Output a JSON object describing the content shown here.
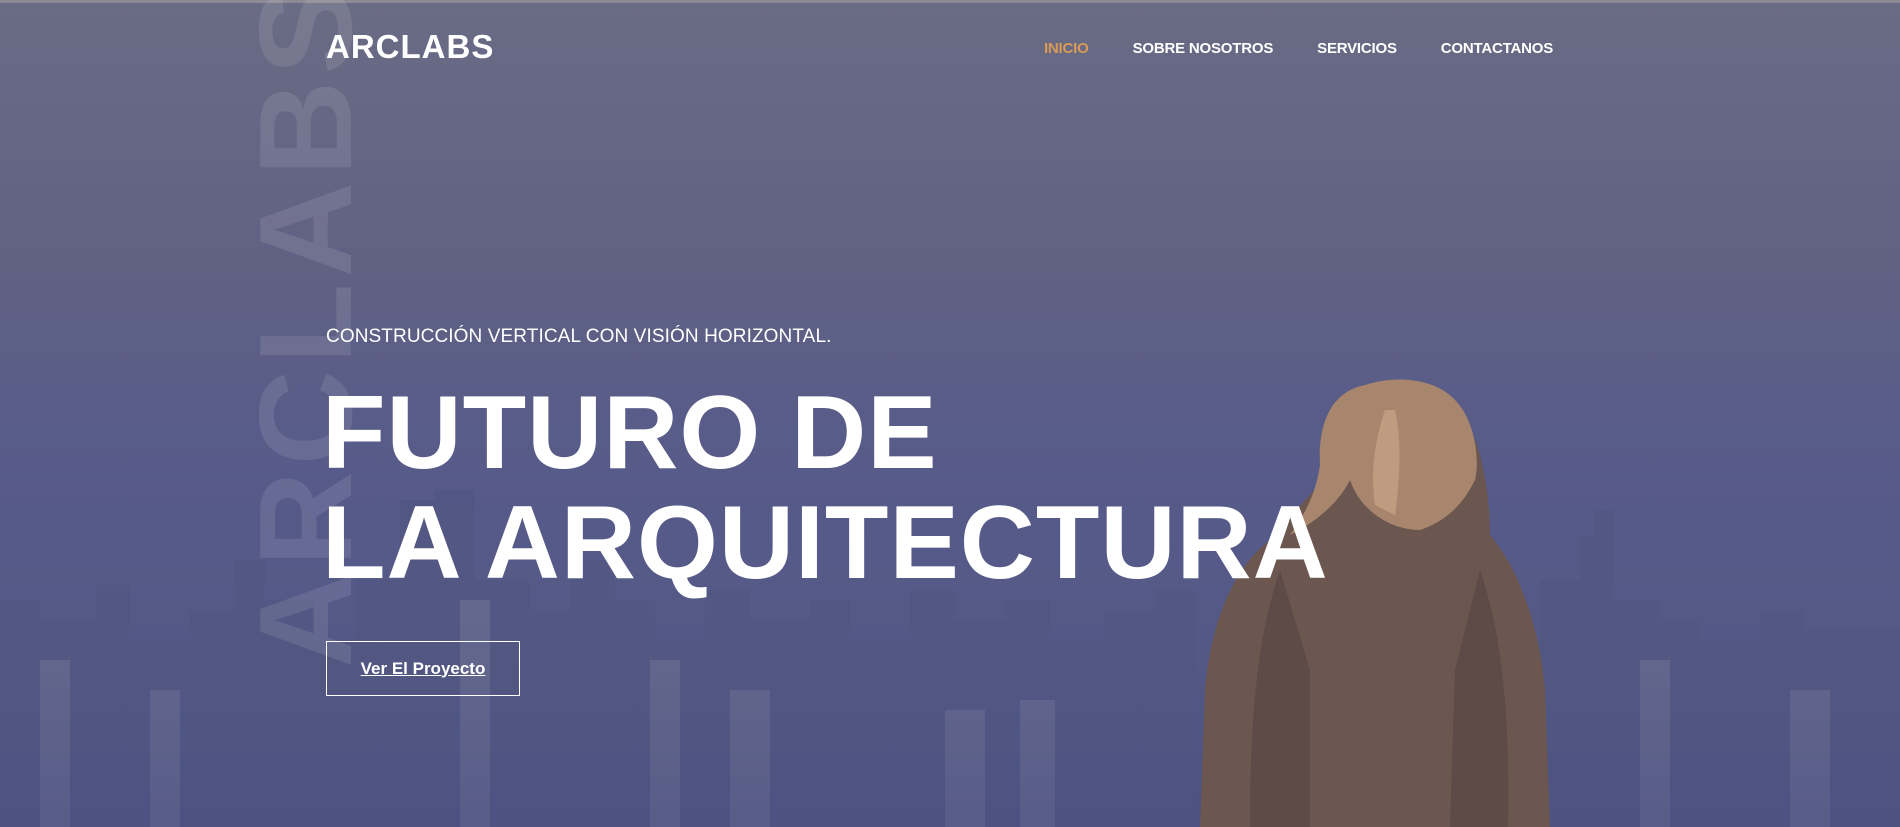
{
  "brand": {
    "logo_text": "ARCLABS",
    "watermark_text": "ARCLABS"
  },
  "nav": {
    "items": [
      {
        "label": "INICIO",
        "active": true
      },
      {
        "label": "SOBRE NOSOTROS",
        "active": false
      },
      {
        "label": "SERVICIOS",
        "active": false
      },
      {
        "label": "CONTACTANOS",
        "active": false
      }
    ]
  },
  "hero": {
    "tagline": "CONSTRUCCIÓN VERTICAL CON VISIÓN HORIZONTAL.",
    "headline_line1": "FUTURO DE",
    "headline_line2": "LA ARQUITECTURA",
    "cta_label": "Ver El Proyecto"
  },
  "colors": {
    "accent": "#d99a57",
    "text": "#ffffff",
    "overlay": "#5f6184"
  }
}
